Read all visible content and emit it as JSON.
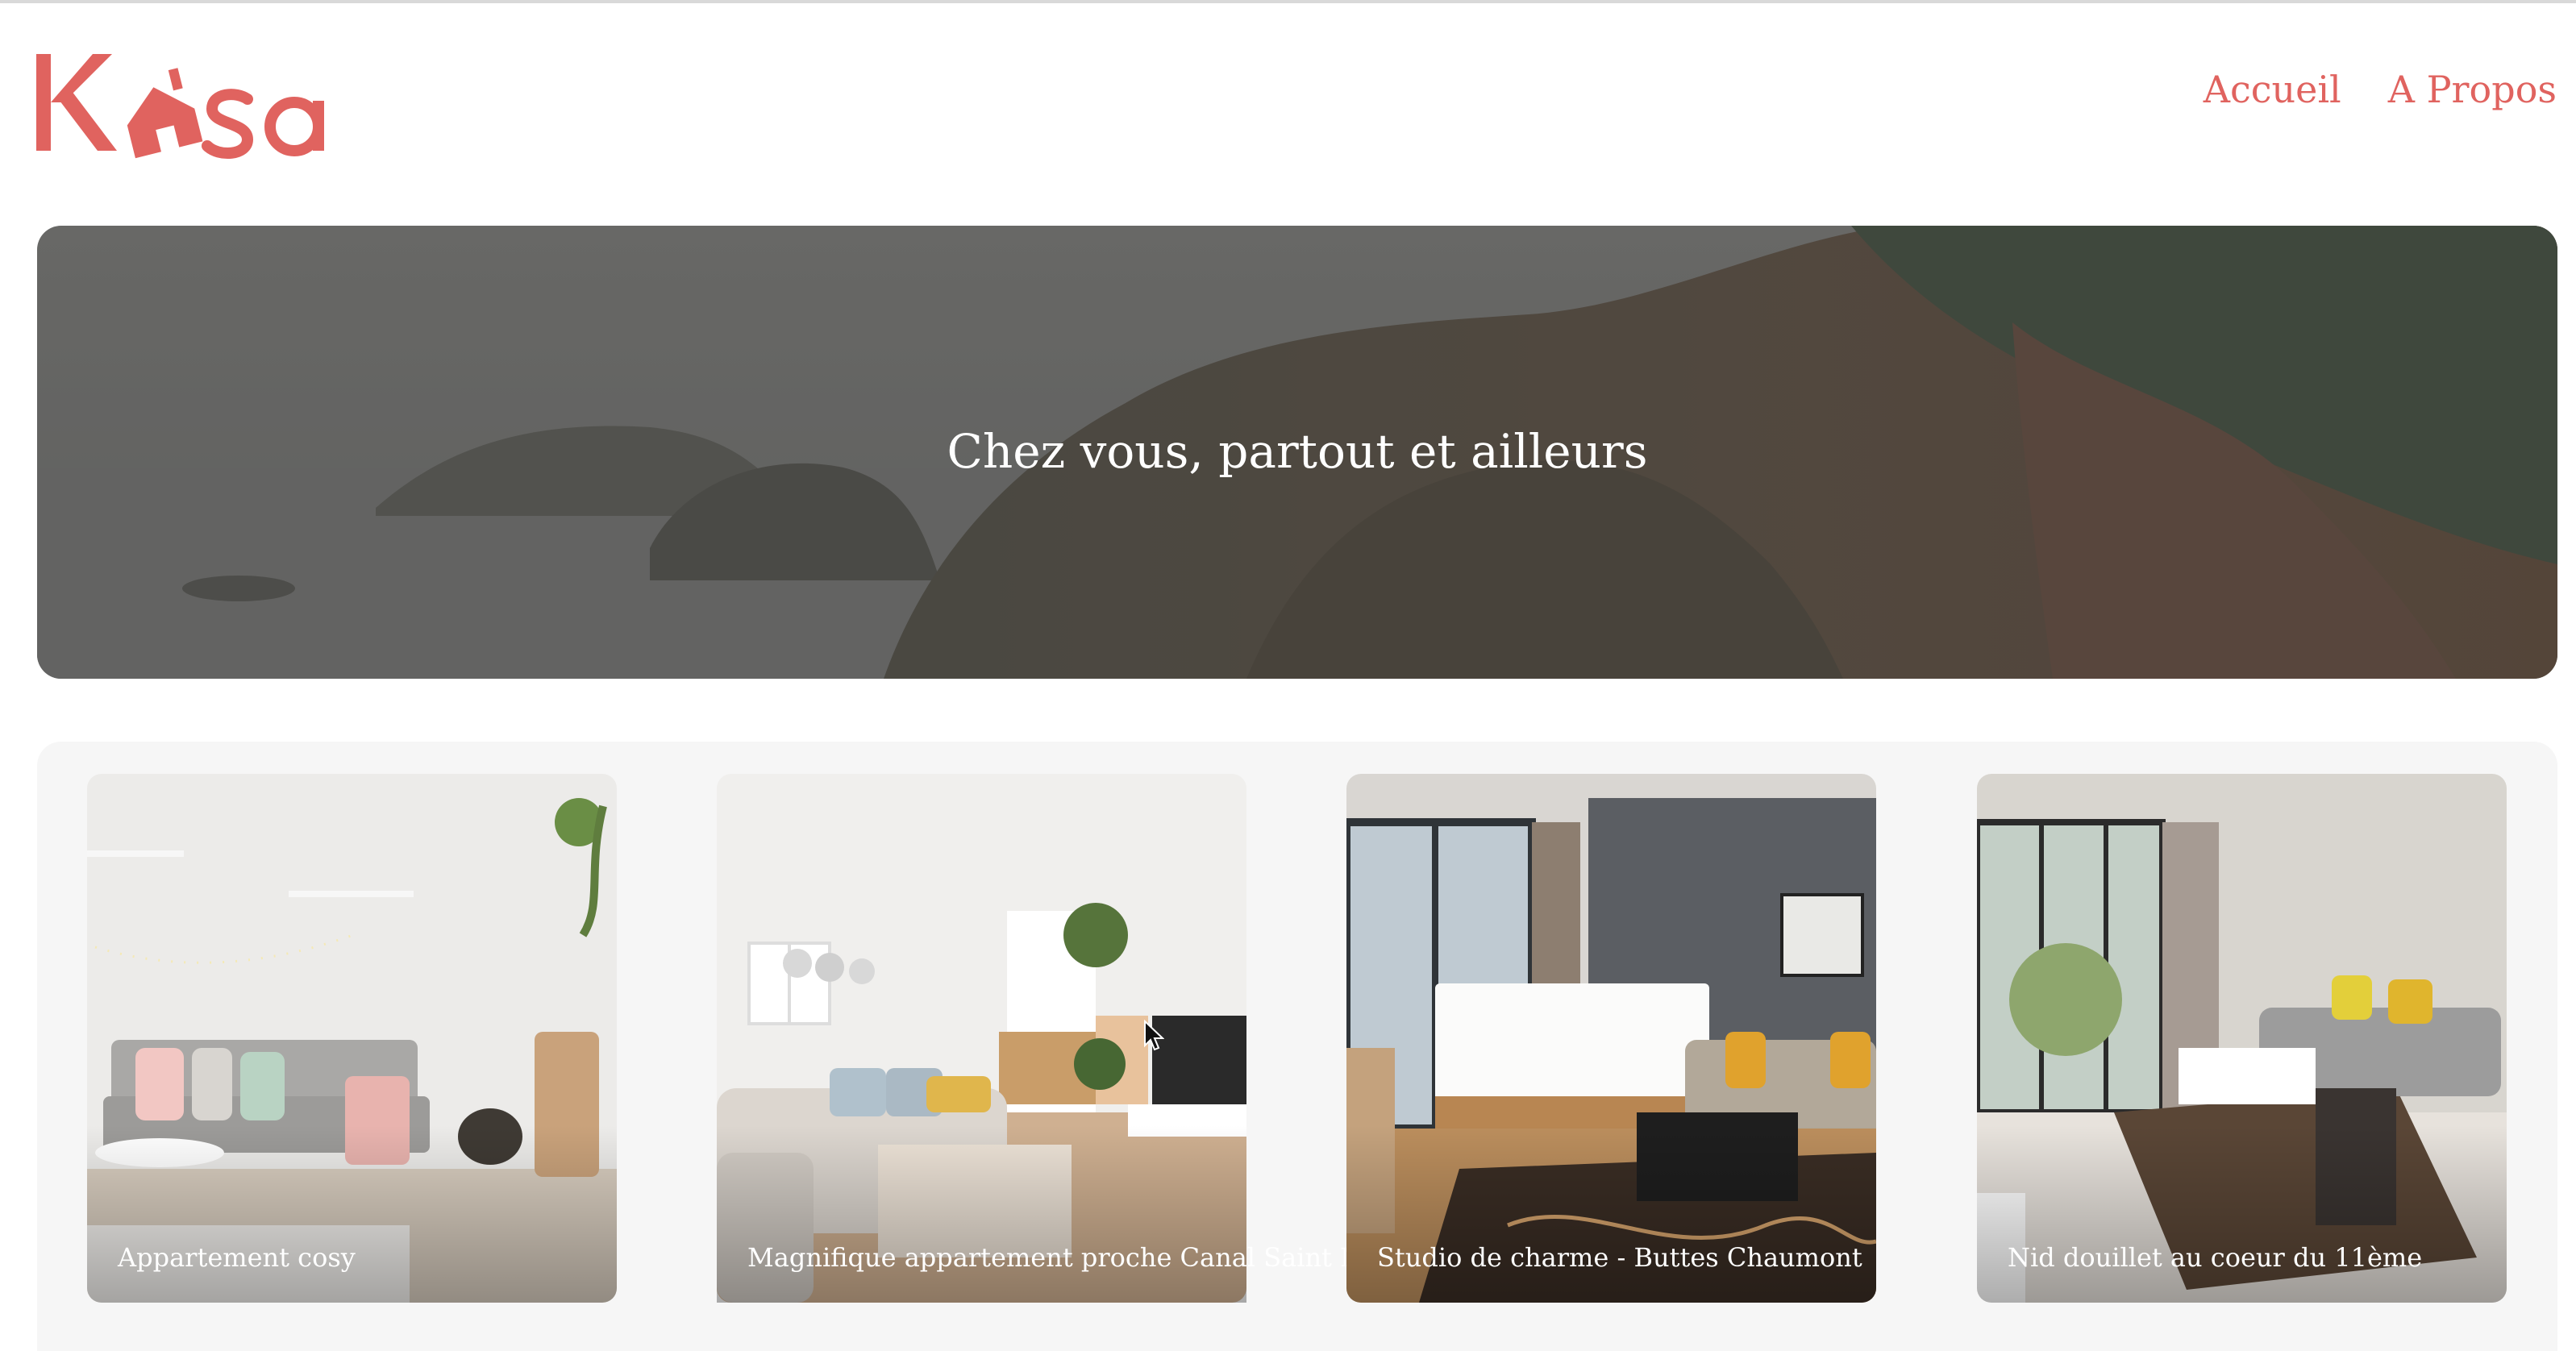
{
  "brand": {
    "logo_text": "Kasa",
    "color": "#e0635f"
  },
  "nav": {
    "items": [
      "Accueil",
      "A Propos"
    ]
  },
  "banner": {
    "title": "Chez vous, partout et ailleurs"
  },
  "listings": [
    {
      "title": "Appartement cosy"
    },
    {
      "title": "Magnifique appartement proche Canal Saint Martin"
    },
    {
      "title": "Studio de charme - Buttes Chaumont"
    },
    {
      "title": "Nid douillet au coeur du 11ème"
    }
  ]
}
